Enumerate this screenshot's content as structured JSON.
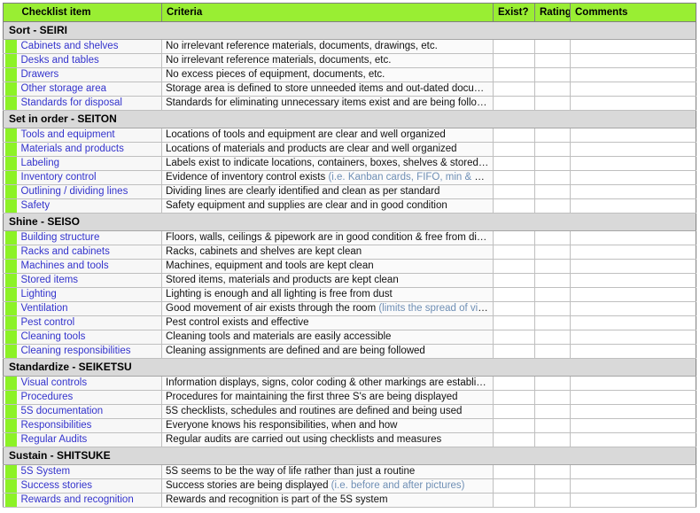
{
  "columns": {
    "swatch": "",
    "item": "Checklist item",
    "criteria": "Criteria",
    "exist": "Exist?",
    "rating": "Rating",
    "comments": "Comments"
  },
  "colors": {
    "header_green": "#99ee33",
    "swatch_green": "#8cf226",
    "section_gray": "#d9d9d9",
    "item_text_blue": "#3333cc",
    "note_text_blue": "#6f8fb5",
    "grid_border": "#bfbfbf",
    "outer_border": "#808080"
  },
  "sections": [
    {
      "title": "Sort - SEIRI",
      "rows": [
        {
          "item": "Cabinets and shelves",
          "criteria": "No irrelevant reference materials, documents, drawings, etc.",
          "note": "",
          "exist": "",
          "rating": "",
          "comments": ""
        },
        {
          "item": "Desks and tables",
          "criteria": "No irrelevant reference materials, documents, etc.",
          "note": "",
          "exist": "",
          "rating": "",
          "comments": ""
        },
        {
          "item": "Drawers",
          "criteria": "No excess pieces of equipment, documents, etc.",
          "note": "",
          "exist": "",
          "rating": "",
          "comments": ""
        },
        {
          "item": "Other storage area",
          "criteria": "Storage area is defined to store unneeded items and out-dated documents",
          "note": "",
          "exist": "",
          "rating": "",
          "comments": ""
        },
        {
          "item": "Standards for disposal",
          "criteria": "Standards for eliminating unnecessary items exist and are being followed",
          "note": "",
          "exist": "",
          "rating": "",
          "comments": ""
        }
      ]
    },
    {
      "title": "Set in order - SEITON",
      "rows": [
        {
          "item": "Tools and equipment",
          "criteria": "Locations of tools and equipment are clear and well organized",
          "note": "",
          "exist": "",
          "rating": "",
          "comments": ""
        },
        {
          "item": "Materials and products",
          "criteria": "Locations of materials and products are clear and well organized",
          "note": "",
          "exist": "",
          "rating": "",
          "comments": ""
        },
        {
          "item": "Labeling",
          "criteria": "Labels exist to indicate locations, containers, boxes, shelves & stored items",
          "note": "",
          "exist": "",
          "rating": "",
          "comments": ""
        },
        {
          "item": "Inventory control",
          "criteria": "Evidence of inventory control exists ",
          "note": "(i.e. Kanban cards, FIFO, min & max)",
          "exist": "",
          "rating": "",
          "comments": ""
        },
        {
          "item": "Outlining / dividing lines",
          "criteria": "Dividing lines are clearly identified and clean as per standard",
          "note": "",
          "exist": "",
          "rating": "",
          "comments": ""
        },
        {
          "item": "Safety",
          "criteria": "Safety equipment and supplies are clear and in good condition",
          "note": "",
          "exist": "",
          "rating": "",
          "comments": ""
        }
      ]
    },
    {
      "title": "Shine - SEISO",
      "rows": [
        {
          "item": "Building structure",
          "criteria": "Floors, walls, ceilings & pipework are in good condition & free from dirt/dust",
          "note": "",
          "exist": "",
          "rating": "",
          "comments": ""
        },
        {
          "item": "Racks and cabinets",
          "criteria": "Racks, cabinets and shelves are kept clean",
          "note": "",
          "exist": "",
          "rating": "",
          "comments": ""
        },
        {
          "item": "Machines and tools",
          "criteria": "Machines, equipment and tools are kept clean",
          "note": "",
          "exist": "",
          "rating": "",
          "comments": ""
        },
        {
          "item": "Stored items",
          "criteria": "Stored items, materials and products are kept clean",
          "note": "",
          "exist": "",
          "rating": "",
          "comments": ""
        },
        {
          "item": "Lighting",
          "criteria": "Lighting is enough and all lighting is free from dust",
          "note": "",
          "exist": "",
          "rating": "",
          "comments": ""
        },
        {
          "item": "Ventilation",
          "criteria": "Good movement of air exists through the room ",
          "note": "(limits the spread of viruses)",
          "exist": "",
          "rating": "",
          "comments": ""
        },
        {
          "item": "Pest control",
          "criteria": "Pest control exists and effective",
          "note": "",
          "exist": "",
          "rating": "",
          "comments": ""
        },
        {
          "item": "Cleaning tools",
          "criteria": "Cleaning tools and materials are easily accessible",
          "note": "",
          "exist": "",
          "rating": "",
          "comments": ""
        },
        {
          "item": "Cleaning responsibilities",
          "criteria": "Cleaning assignments are defined and are being followed",
          "note": "",
          "exist": "",
          "rating": "",
          "comments": ""
        }
      ]
    },
    {
      "title": "Standardize - SEIKETSU",
      "rows": [
        {
          "item": "Visual controls",
          "criteria": "Information displays, signs, color coding & other markings are established",
          "note": "",
          "exist": "",
          "rating": "",
          "comments": ""
        },
        {
          "item": "Procedures",
          "criteria": "Procedures for maintaining the first three S's are being displayed",
          "note": "",
          "exist": "",
          "rating": "",
          "comments": ""
        },
        {
          "item": "5S documentation",
          "criteria": "5S checklists, schedules and routines are defined and being used",
          "note": "",
          "exist": "",
          "rating": "",
          "comments": ""
        },
        {
          "item": "Responsibilities",
          "criteria": "Everyone knows his responsibilities, when and how",
          "note": "",
          "exist": "",
          "rating": "",
          "comments": ""
        },
        {
          "item": "Regular Audits",
          "criteria": "Regular audits are carried out using checklists and measures",
          "note": "",
          "exist": "",
          "rating": "",
          "comments": ""
        }
      ]
    },
    {
      "title": "Sustain - SHITSUKE",
      "rows": [
        {
          "item": "5S System",
          "criteria": "5S seems to be the way of life rather than just a routine",
          "note": "",
          "exist": "",
          "rating": "",
          "comments": ""
        },
        {
          "item": "Success stories",
          "criteria": "Success stories are being displayed ",
          "note": "(i.e. before and after pictures)",
          "exist": "",
          "rating": "",
          "comments": ""
        },
        {
          "item": "Rewards and recognition",
          "criteria": "Rewards and recognition is part of the 5S system",
          "note": "",
          "exist": "",
          "rating": "",
          "comments": ""
        }
      ]
    }
  ]
}
